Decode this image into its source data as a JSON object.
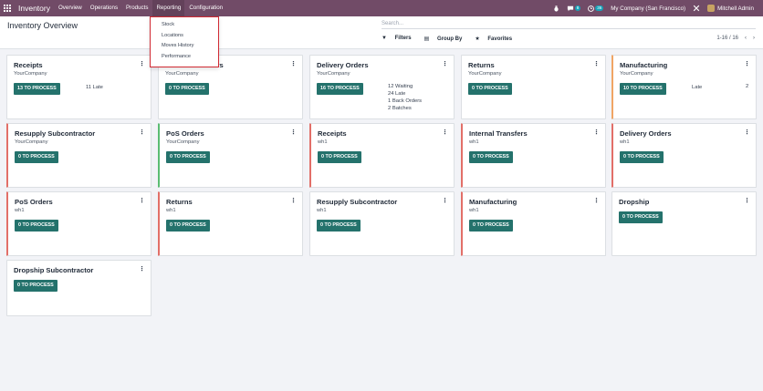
{
  "navbar": {
    "app_name": "Inventory",
    "menu": [
      "Overview",
      "Operations",
      "Products",
      "Reporting",
      "Configuration"
    ],
    "activity_count": "8",
    "chat_count": "36",
    "company": "My Company (San Francisco)",
    "user": "Mitchell Admin"
  },
  "reporting_menu": [
    "Stock",
    "Locations",
    "Moves History",
    "Performance"
  ],
  "control": {
    "title": "Inventory Overview",
    "search_placeholder": "Search...",
    "filters": "Filters",
    "group_by": "Group By",
    "favorites": "Favorites",
    "pager": "1-16 / 16"
  },
  "cards": [
    {
      "title": "Receipts",
      "sub": "YourCompany",
      "button": "13 TO PROCESS",
      "stats": [
        "11 Late"
      ],
      "stat_num": "",
      "bar": "none"
    },
    {
      "title": "Internal Transfers",
      "sub": "YourCompany",
      "button": "0 TO PROCESS",
      "stats": [],
      "stat_num": "",
      "bar": "none"
    },
    {
      "title": "Delivery Orders",
      "sub": "YourCompany",
      "button": "16 TO PROCESS",
      "stats": [
        "12 Waiting",
        "24 Late",
        "1 Back Orders",
        "2 Batches"
      ],
      "stat_num": "",
      "bar": "none"
    },
    {
      "title": "Returns",
      "sub": "YourCompany",
      "button": "0 TO PROCESS",
      "stats": [],
      "stat_num": "",
      "bar": "none"
    },
    {
      "title": "Manufacturing",
      "sub": "YourCompany",
      "button": "10 TO PROCESS",
      "stats": [
        "Late"
      ],
      "stat_num": "2",
      "bar": "orange"
    },
    {
      "title": "Resupply Subcontractor",
      "sub": "YourCompany",
      "button": "0 TO PROCESS",
      "stats": [],
      "stat_num": "",
      "bar": "red"
    },
    {
      "title": "PoS Orders",
      "sub": "YourCompany",
      "button": "0 TO PROCESS",
      "stats": [],
      "stat_num": "",
      "bar": "green"
    },
    {
      "title": "Receipts",
      "sub": "wh1",
      "button": "0 TO PROCESS",
      "stats": [],
      "stat_num": "",
      "bar": "red"
    },
    {
      "title": "Internal Transfers",
      "sub": "wh1",
      "button": "0 TO PROCESS",
      "stats": [],
      "stat_num": "",
      "bar": "red"
    },
    {
      "title": "Delivery Orders",
      "sub": "wh1",
      "button": "0 TO PROCESS",
      "stats": [],
      "stat_num": "",
      "bar": "red"
    },
    {
      "title": "PoS Orders",
      "sub": "wh1",
      "button": "0 TO PROCESS",
      "stats": [],
      "stat_num": "",
      "bar": "red"
    },
    {
      "title": "Returns",
      "sub": "wh1",
      "button": "0 TO PROCESS",
      "stats": [],
      "stat_num": "",
      "bar": "red"
    },
    {
      "title": "Resupply Subcontractor",
      "sub": "wh1",
      "button": "0 TO PROCESS",
      "stats": [],
      "stat_num": "",
      "bar": "none"
    },
    {
      "title": "Manufacturing",
      "sub": "wh1",
      "button": "0 TO PROCESS",
      "stats": [],
      "stat_num": "",
      "bar": "red"
    },
    {
      "title": "Dropship",
      "sub": "",
      "button": "0 TO PROCESS",
      "stats": [],
      "stat_num": "",
      "bar": "none"
    },
    {
      "title": "Dropship Subcontractor",
      "sub": "",
      "button": "0 TO PROCESS",
      "stats": [],
      "stat_num": "",
      "bar": "none"
    }
  ],
  "colors": {
    "navbar": "#714b67",
    "button": "#24726c",
    "highlight": "#d12a33",
    "bar_red": "#e26f68",
    "bar_green": "#5bbd72",
    "bar_orange": "#f0a564"
  }
}
